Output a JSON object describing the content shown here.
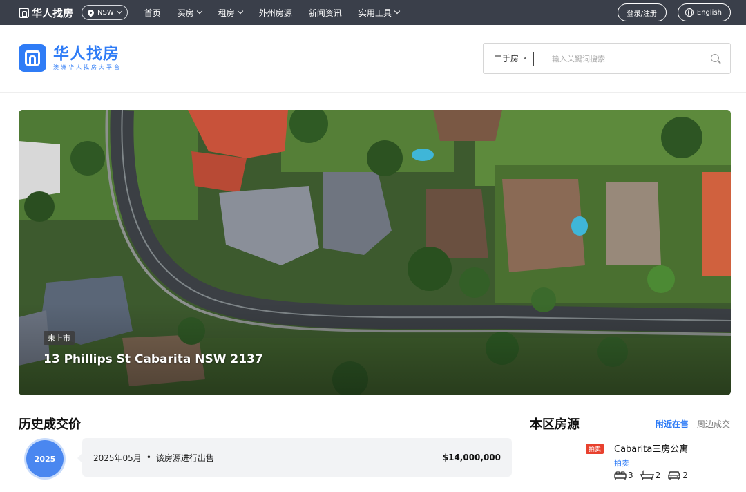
{
  "topbar": {
    "logo_text": "华人找房",
    "region": "NSW",
    "nav": [
      {
        "label": "首页",
        "dropdown": false
      },
      {
        "label": "买房",
        "dropdown": true
      },
      {
        "label": "租房",
        "dropdown": true
      },
      {
        "label": "外州房源",
        "dropdown": false
      },
      {
        "label": "新闻资讯",
        "dropdown": false
      },
      {
        "label": "实用工具",
        "dropdown": true
      }
    ],
    "login_label": "登录/注册",
    "lang_label": "English"
  },
  "header": {
    "brand_title": "华人找房",
    "brand_subtitle": "澳洲华人找房大平台",
    "search_type": "二手房",
    "search_placeholder": "输入关键词搜索"
  },
  "hero": {
    "status_badge": "未上市",
    "address": "13 Phillips St Cabarita NSW 2137"
  },
  "history": {
    "title": "历史成交价",
    "entries": [
      {
        "year": "2025",
        "date": "2025年05月",
        "separator": "•",
        "description": "该房源进行出售",
        "price": "$14,000,000"
      }
    ]
  },
  "area": {
    "title": "本区房源",
    "tab_nearby": "附近在售",
    "tab_sold": "周边成交",
    "listing": {
      "tag": "拍卖",
      "title": "Cabarita三房公寓",
      "sale_type": "拍卖",
      "bedrooms": "3",
      "bathrooms": "2",
      "parking": "2"
    }
  },
  "colors": {
    "topbar_bg": "#3a3f4a",
    "accent_blue": "#2f7cf6",
    "auction_red": "#e8412e"
  }
}
